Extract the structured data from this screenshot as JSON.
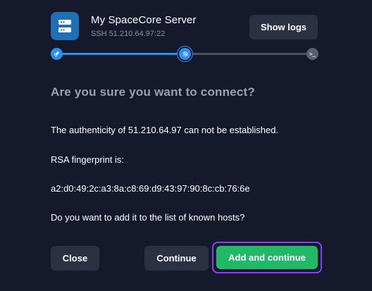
{
  "server": {
    "name": "My SpaceCore Server",
    "subtitle": "SSH 51.210.64.97:22",
    "icon": "server-icon"
  },
  "header": {
    "show_logs_label": "Show logs"
  },
  "progress": {
    "steps": [
      {
        "icon": "rocket-icon",
        "state": "complete"
      },
      {
        "icon": "fingerprint-icon",
        "state": "active"
      },
      {
        "icon": "terminal-icon",
        "state": "pending",
        "glyph": ">_"
      }
    ]
  },
  "dialog": {
    "title": "Are you sure you want to connect?",
    "authenticity_text": "The authenticity of 51.210.64.97 can not be established.",
    "fingerprint_label": "RSA fingerprint is:",
    "fingerprint": "a2:d0:49:2c:a3:8a:c8:69:d9:43:97:90:8c:cb:76:6e",
    "question": "Do you want to add it to the list of known hosts?"
  },
  "actions": {
    "close_label": "Close",
    "continue_label": "Continue",
    "add_continue_label": "Add and continue"
  },
  "colors": {
    "background": "#141a2b",
    "accent_blue": "#2f8ff0",
    "primary_green": "#21b868",
    "focus_purple": "#8b3ff3",
    "secondary_button": "#2b3142"
  }
}
